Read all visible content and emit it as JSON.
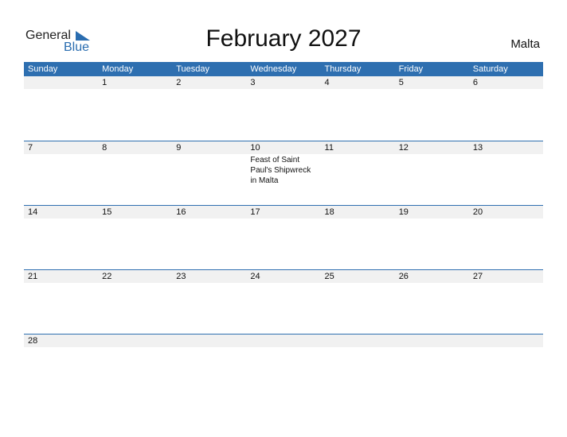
{
  "logo": {
    "word1": "General",
    "word2": "Blue"
  },
  "title": "February 2027",
  "country": "Malta",
  "colors": {
    "accent": "#2e6fb0",
    "band": "#f1f1f1"
  },
  "weekdays": [
    "Sunday",
    "Monday",
    "Tuesday",
    "Wednesday",
    "Thursday",
    "Friday",
    "Saturday"
  ],
  "weeks": [
    [
      "",
      "1",
      "2",
      "3",
      "4",
      "5",
      "6"
    ],
    [
      "7",
      "8",
      "9",
      "10",
      "11",
      "12",
      "13"
    ],
    [
      "14",
      "15",
      "16",
      "17",
      "18",
      "19",
      "20"
    ],
    [
      "21",
      "22",
      "23",
      "24",
      "25",
      "26",
      "27"
    ],
    [
      "28",
      "",
      "",
      "",
      "",
      "",
      ""
    ]
  ],
  "events": [
    {
      "week": 1,
      "day": 3,
      "text": "Feast of Saint Paul's Shipwreck in Malta"
    }
  ]
}
